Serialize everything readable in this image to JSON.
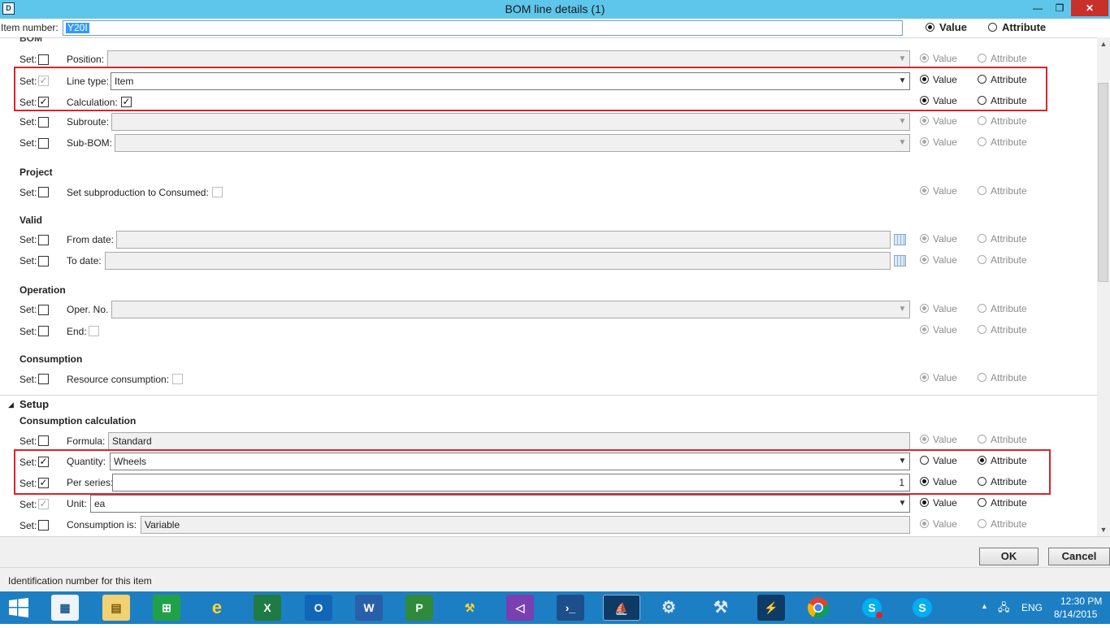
{
  "window": {
    "title": "BOM line details (1)",
    "controls": {
      "minimize": "—",
      "maximize": "❐",
      "close": "✕"
    }
  },
  "item_bar": {
    "label": "Item number:",
    "value": "Y20I",
    "value_label": "Value",
    "attribute_label": "Attribute",
    "selected": "Value"
  },
  "common": {
    "set": "Set:",
    "value": "Value",
    "attribute": "Attribute"
  },
  "groups": {
    "bom": {
      "label": "BOM"
    },
    "project": {
      "label": "Project"
    },
    "valid": {
      "label": "Valid"
    },
    "operation": {
      "label": "Operation"
    },
    "consumption": {
      "label": "Consumption"
    },
    "setup": {
      "label": "Setup",
      "subgroup": "Consumption calculation"
    }
  },
  "fields": {
    "position": {
      "label": "Position:",
      "value": "",
      "set": false,
      "mode": "Value",
      "enabled": false
    },
    "line_type": {
      "label": "Line type:",
      "value": "Item",
      "set": true,
      "set_disabled": true,
      "mode": "Value",
      "enabled": true
    },
    "calculation": {
      "label": "Calculation:",
      "checked": true,
      "set": true,
      "mode": "Value",
      "enabled": true
    },
    "subroute": {
      "label": "Subroute:",
      "value": "",
      "set": false,
      "mode": "Value",
      "enabled": false
    },
    "sub_bom": {
      "label": "Sub-BOM:",
      "value": "",
      "set": false,
      "mode": "Value",
      "enabled": false
    },
    "set_subproduction": {
      "label": "Set subproduction to Consumed:",
      "checked": false,
      "set": false,
      "mode": "Value",
      "enabled": false
    },
    "from_date": {
      "label": "From date:",
      "value": "",
      "set": false,
      "mode": "Value",
      "enabled": false
    },
    "to_date": {
      "label": "To date:",
      "value": "",
      "set": false,
      "mode": "Value",
      "enabled": false
    },
    "oper_no": {
      "label": "Oper. No.",
      "value": "",
      "set": false,
      "mode": "Value",
      "enabled": false
    },
    "end": {
      "label": "End:",
      "checked": false,
      "set": false,
      "mode": "Value",
      "enabled": false
    },
    "resource_consumption": {
      "label": "Resource consumption:",
      "checked": false,
      "set": false,
      "mode": "Value",
      "enabled": false
    },
    "formula": {
      "label": "Formula:",
      "value": "Standard",
      "set": false,
      "mode": "Value",
      "enabled": false
    },
    "quantity": {
      "label": "Quantity:",
      "value": "Wheels",
      "set": true,
      "mode": "Attribute",
      "enabled": true
    },
    "per_series": {
      "label": "Per series:",
      "value": "1",
      "set": true,
      "mode": "Value",
      "enabled": true
    },
    "unit": {
      "label": "Unit:",
      "value": "ea",
      "set": true,
      "set_disabled": true,
      "mode": "Value",
      "enabled": true
    },
    "consumption_is": {
      "label": "Consumption is:",
      "value": "Variable",
      "set": false,
      "mode": "Value",
      "enabled": false
    }
  },
  "buttons": {
    "ok": "OK",
    "cancel": "Cancel"
  },
  "status_text": "Identification number for this item",
  "taskbar": {
    "apps": [
      "windows-start",
      "server-manager",
      "file-explorer",
      "store",
      "internet-explorer",
      "excel",
      "outlook",
      "word",
      "project",
      "sql-tools",
      "visual-studio",
      "powershell",
      "dynamics-ax",
      "settings",
      "tools",
      "ax-config",
      "chrome",
      "skype-business",
      "skype"
    ],
    "lang": "ENG",
    "time": "12:30 PM",
    "date": "8/14/2015"
  },
  "colors": {
    "titlebar": "#5ec6ea",
    "highlight": "#d9232e",
    "taskbar": "#1d7fc3",
    "selection": "#3399ff"
  }
}
